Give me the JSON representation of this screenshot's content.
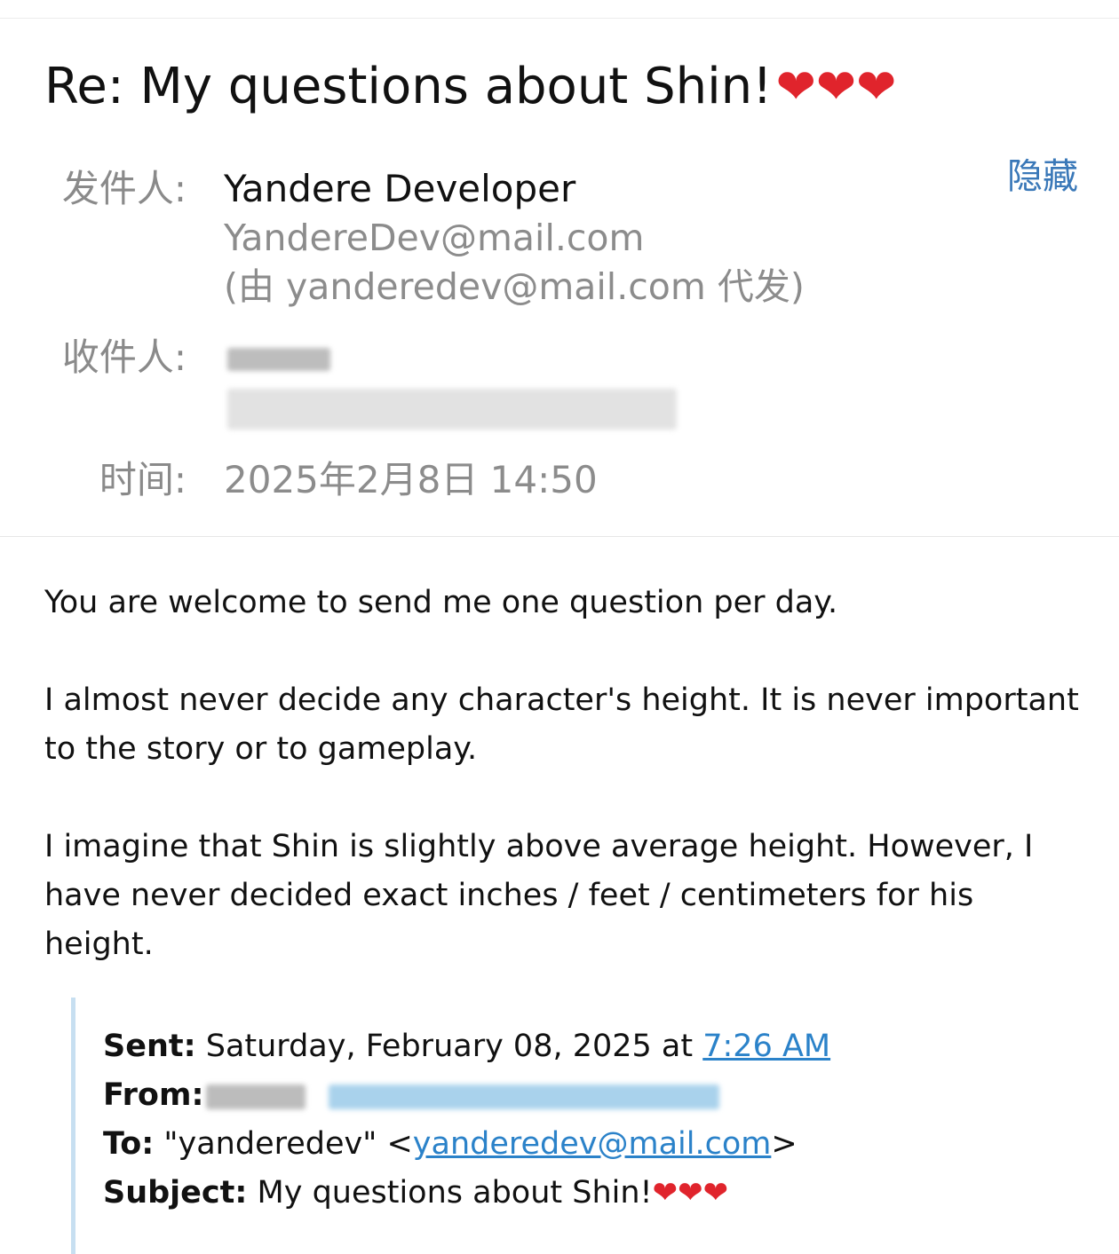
{
  "email": {
    "subject": "Re: My questions about Shin!",
    "subject_hearts": "❤❤❤",
    "hide_label": "隐藏",
    "from_label": "发件人:",
    "from_name": "Yandere Developer",
    "from_email": "YandereDev@mail.com",
    "from_sent_on_behalf": "(由 yanderedev@mail.com 代发)",
    "to_label": "收件人:",
    "time_label": "时间:",
    "time_value": "2025年2月8日 14:50"
  },
  "body": {
    "paragraphs": [
      "You are welcome to send me one question per day.",
      "I almost never decide any character's height. It is never important to the story or to gameplay.",
      "I imagine that Shin is slightly above average height. However, I have never decided exact inches / feet / centimeters for his height."
    ]
  },
  "quoted": {
    "sent_label": "Sent:",
    "sent_value": "Saturday, February 08, 2025 at",
    "sent_time_link": "7:26 AM",
    "from_label": "From:",
    "to_label": "To:",
    "to_name": "\"yanderedev\" <",
    "to_email_link": "yanderedev@mail.com",
    "to_close": ">",
    "subject_label": "Subject:",
    "subject_value": "My questions about Shin!",
    "subject_hearts": "❤❤❤"
  },
  "colors": {
    "accent_link": "#2b82c9",
    "hide_link": "#3a78b8",
    "heart": "#e0242c",
    "quote_bar": "#c7dff1"
  }
}
